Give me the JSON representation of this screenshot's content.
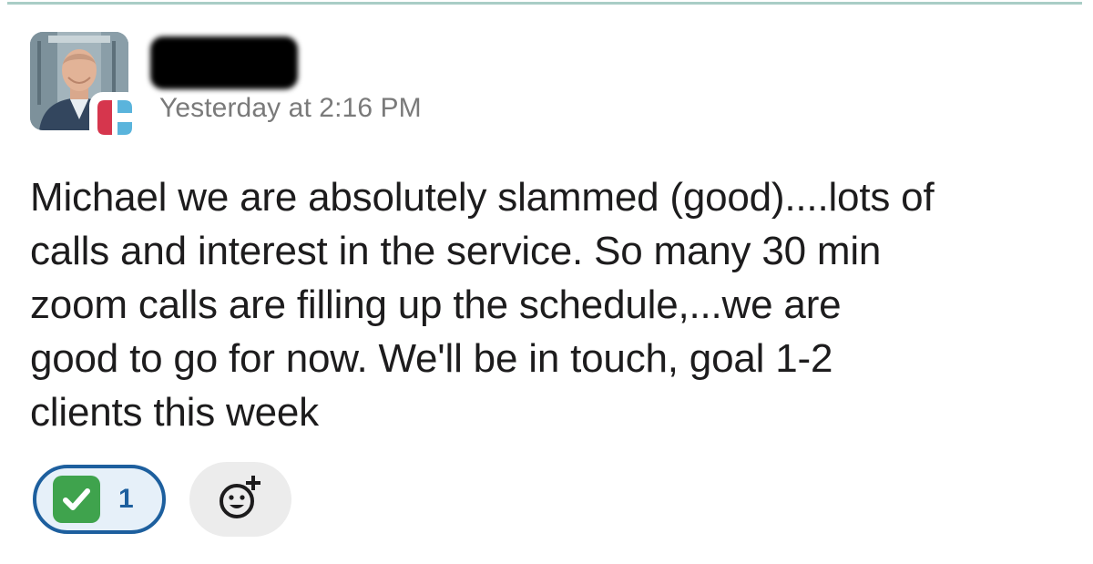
{
  "message": {
    "sender_name": "",
    "timestamp": "Yesterday at 2:16 PM",
    "text_lines": [
      "Michael we are absolutely slammed (good)....lots of",
      "calls and interest in the service. So many 30 min",
      "zoom calls are filling up the schedule,...we are",
      "good to go for now. We'll be in touch, goal 1-2",
      "clients this week"
    ]
  },
  "reactions": [
    {
      "emoji": "white-check-mark-icon",
      "count": "1",
      "selected": true
    }
  ],
  "add_reaction": {
    "icon": "add-reaction-icon"
  },
  "colors": {
    "divider": "#a9cdc6",
    "reaction_border": "#1d5f9e",
    "reaction_bg": "#e6f0f9",
    "check_green": "#3fa34d",
    "timestamp": "#7a7a7a",
    "badge_red": "#d6364d",
    "badge_blue": "#5ab4dc"
  }
}
